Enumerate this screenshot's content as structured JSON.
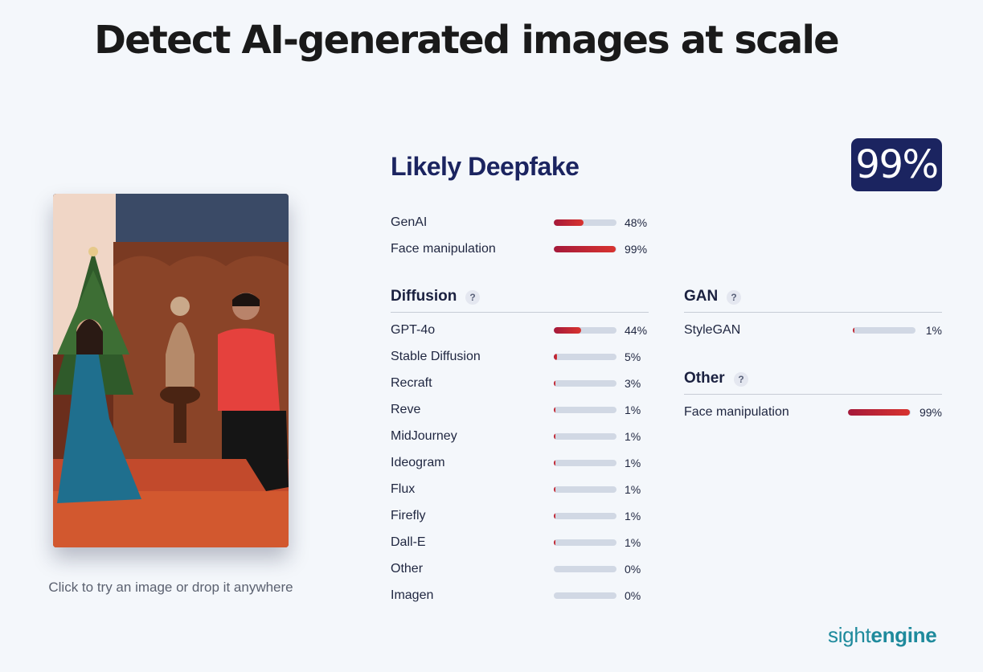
{
  "hero": {
    "title": "Detect AI-generated images at scale"
  },
  "upload": {
    "caption": "Click to try an image or drop it anywhere"
  },
  "result": {
    "verdict": "Likely Deepfake",
    "score": "99%",
    "summary": [
      {
        "label": "GenAI",
        "value": 48,
        "text": "48%"
      },
      {
        "label": "Face manipulation",
        "value": 99,
        "text": "99%"
      }
    ]
  },
  "diffusion": {
    "title": "Diffusion",
    "help": "?",
    "items": [
      {
        "label": "GPT-4o",
        "value": 44,
        "text": "44%"
      },
      {
        "label": "Stable Diffusion",
        "value": 5,
        "text": "5%"
      },
      {
        "label": "Recraft",
        "value": 3,
        "text": "3%"
      },
      {
        "label": "Reve",
        "value": 1,
        "text": "1%"
      },
      {
        "label": "MidJourney",
        "value": 1,
        "text": "1%"
      },
      {
        "label": "Ideogram",
        "value": 1,
        "text": "1%"
      },
      {
        "label": "Flux",
        "value": 1,
        "text": "1%"
      },
      {
        "label": "Firefly",
        "value": 1,
        "text": "1%"
      },
      {
        "label": "Dall-E",
        "value": 1,
        "text": "1%"
      },
      {
        "label": "Other",
        "value": 0,
        "text": "0%"
      },
      {
        "label": "Imagen",
        "value": 0,
        "text": "0%"
      }
    ]
  },
  "gan": {
    "title": "GAN",
    "help": "?",
    "items": [
      {
        "label": "StyleGAN",
        "value": 1,
        "text": "1%"
      }
    ]
  },
  "other": {
    "title": "Other",
    "help": "?",
    "items": [
      {
        "label": "Face manipulation",
        "value": 99,
        "text": "99%"
      }
    ]
  },
  "brand": {
    "light": "sight",
    "bold": "engine"
  },
  "colors": {
    "accent_navy": "#1b2460",
    "bar_fill_start": "#a5193a",
    "bar_fill_end": "#d8332f",
    "bar_track": "#d1d8e4",
    "brand_teal": "#1e8a9c"
  }
}
